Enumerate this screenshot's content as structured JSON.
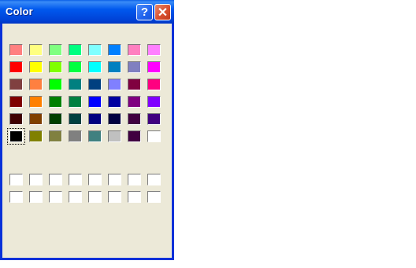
{
  "window": {
    "title": "Color"
  },
  "titlebar": {
    "help_glyph": "?",
    "close_glyph": "✕"
  },
  "colors": {
    "basic": [
      [
        "#ff8080",
        "#ffff80",
        "#80ff80",
        "#00ff80",
        "#80ffff",
        "#0080ff",
        "#ff80c0",
        "#ff80ff"
      ],
      [
        "#ff0000",
        "#ffff00",
        "#80ff00",
        "#00ff40",
        "#00ffff",
        "#0080c0",
        "#8080c0",
        "#ff00ff"
      ],
      [
        "#804040",
        "#ff8040",
        "#00ff00",
        "#008080",
        "#004080",
        "#8080ff",
        "#800040",
        "#ff0080"
      ],
      [
        "#800000",
        "#ff8000",
        "#008000",
        "#008040",
        "#0000ff",
        "#0000a0",
        "#800080",
        "#8000ff"
      ],
      [
        "#400000",
        "#804000",
        "#004000",
        "#004040",
        "#000080",
        "#000040",
        "#400040",
        "#400080"
      ],
      [
        "#000000",
        "#808000",
        "#808040",
        "#808080",
        "#408080",
        "#c0c0c0",
        "#400040",
        "#ffffff"
      ]
    ],
    "selected": {
      "row": 5,
      "col": 0
    },
    "custom_count": 16
  }
}
